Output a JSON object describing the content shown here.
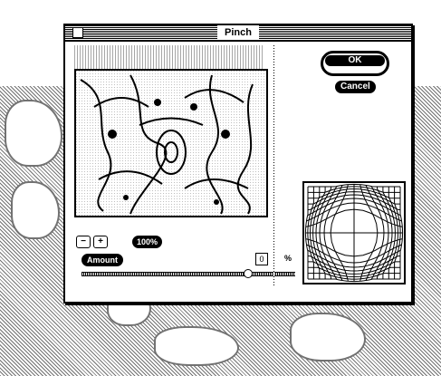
{
  "dialog": {
    "title": "Pinch",
    "ok_label": "OK",
    "cancel_label": "Cancel"
  },
  "zoom": {
    "zoom_out_label": "−",
    "zoom_in_label": "+",
    "level": "100%"
  },
  "amount": {
    "label": "Amount",
    "value": "0",
    "unit": "%",
    "slider_fraction": 0.78
  }
}
